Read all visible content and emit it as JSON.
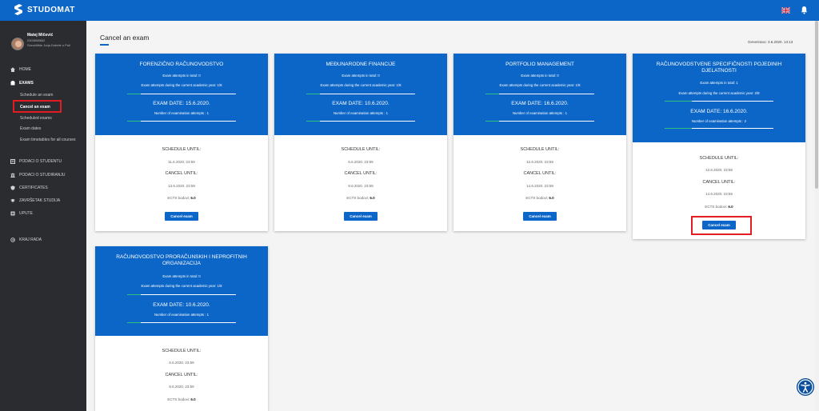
{
  "header": {
    "brand": "STUDOMAT",
    "language_icon": "uk-flag-icon",
    "notification_icon": "bell-icon",
    "accent_color": "#0c66c7"
  },
  "sidebar": {
    "profile": {
      "name": "Matej Mičević",
      "id": "0303658652",
      "university": "Sveučilište Jurja Dobrile u Puli"
    },
    "nav": [
      {
        "label": "HOME",
        "icon": "home-icon"
      },
      {
        "label": "EXAMS",
        "icon": "exams-icon",
        "active": true
      },
      {
        "label": "PODACI O STUDENTU",
        "icon": "student-data-icon"
      },
      {
        "label": "PODACI O STUDIRANJU",
        "icon": "study-data-icon"
      },
      {
        "label": "CERTIFICATES",
        "icon": "certificate-icon"
      },
      {
        "label": "ZAVRŠETAK STUDIJA",
        "icon": "graduation-icon"
      },
      {
        "label": "UPUTE",
        "icon": "instructions-icon"
      },
      {
        "label": "KRAJ RADA",
        "icon": "logout-icon"
      }
    ],
    "exam_sub_items": [
      {
        "label": "Schedule an exam"
      },
      {
        "label": "Cancel an exam",
        "selected": true
      },
      {
        "label": "Scheduled exams"
      },
      {
        "label": "Exam dates"
      },
      {
        "label": "Exam timetables for all courses"
      }
    ]
  },
  "main": {
    "title": "Cancel an exam",
    "generated": "Generirano: 3.6.2020. 13:13",
    "cards": [
      {
        "course": "FORENZIČNO RAČUNOVODSTVO",
        "attempts_total": "Exam attempts in total: 0",
        "attempts_year": "Exam attempts during the current academic year: 1/8",
        "exam_date": "EXAM DATE: 15.6.2020.",
        "attempt_number": "Number of examination attempts : 1",
        "schedule_label": "SCHEDULE UNTIL:",
        "schedule_value": "11.6.2020. 23:59",
        "cancel_label": "CANCEL UNTIL:",
        "cancel_value": "13.6.2020. 23:59",
        "ects_label": "ECTS bodovi:",
        "ects_value": "6.0",
        "button": "Cancel exam",
        "year_progress": 0.125
      },
      {
        "course": "MEĐUNARODNE FINANCIJE",
        "attempts_total": "Exam attempts in total: 0",
        "attempts_year": "Exam attempts during the current academic year: 1/8",
        "exam_date": "EXAM DATE: 10.6.2020.",
        "attempt_number": "Number of examination attempts : 1",
        "schedule_label": "SCHEDULE UNTIL:",
        "schedule_value": "6.6.2020. 23:59",
        "cancel_label": "CANCEL UNTIL:",
        "cancel_value": "8.6.2020. 23:59",
        "ects_label": "ECTS bodovi:",
        "ects_value": "6.0",
        "button": "Cancel exam",
        "year_progress": 0.125
      },
      {
        "course": "PORTFOLIO MANAGEMENT",
        "attempts_total": "Exam attempts in total: 0",
        "attempts_year": "Exam attempts during the current academic year: 1/8",
        "exam_date": "EXAM DATE: 16.6.2020.",
        "attempt_number": "Number of examination attempts : 1",
        "schedule_label": "SCHEDULE UNTIL:",
        "schedule_value": "12.6.2020. 23:59",
        "cancel_label": "CANCEL UNTIL:",
        "cancel_value": "14.6.2020. 23:59",
        "ects_label": "ECTS bodovi:",
        "ects_value": "6.0",
        "button": "Cancel exam",
        "year_progress": 0.125
      },
      {
        "course": "RAČUNOVODSTVENE SPECIFIČNOSTI POJEDINIH DJELATNOSTI",
        "attempts_total": "Exam attempts in total: 1",
        "attempts_year": "Exam attempts during the current academic year: 2/8",
        "exam_date": "EXAM DATE: 16.6.2020.",
        "attempt_number": "Number of examination attempts : 2",
        "schedule_label": "SCHEDULE UNTIL:",
        "schedule_value": "12.6.2020. 23:59",
        "cancel_label": "CANCEL UNTIL:",
        "cancel_value": "14.6.2020. 23:59",
        "ects_label": "ECTS bodovi:",
        "ects_value": "6.0",
        "button": "Cancel exam",
        "year_progress": 0.25
      },
      {
        "course": "RAČUNOVODSTVO PRORAČUNSKIH I NEPROFITNIH ORGANIZACIJA",
        "attempts_total": "Exam attempts in total: 0",
        "attempts_year": "Exam attempts during the current academic year: 1/8",
        "exam_date": "EXAM DATE: 10.6.2020.",
        "attempt_number": "Number of examination attempts : 1",
        "schedule_label": "SCHEDULE UNTIL:",
        "schedule_value": "6.6.2020. 23:59",
        "cancel_label": "CANCEL UNTIL:",
        "cancel_value": "8.6.2020. 23:59",
        "ects_label": "ECTS bodovi:",
        "ects_value": "6.0",
        "button": "Cancel exam",
        "year_progress": 0.125
      }
    ],
    "highlight_color": "#e31b23",
    "accessibility_icon": "accessibility-icon"
  }
}
